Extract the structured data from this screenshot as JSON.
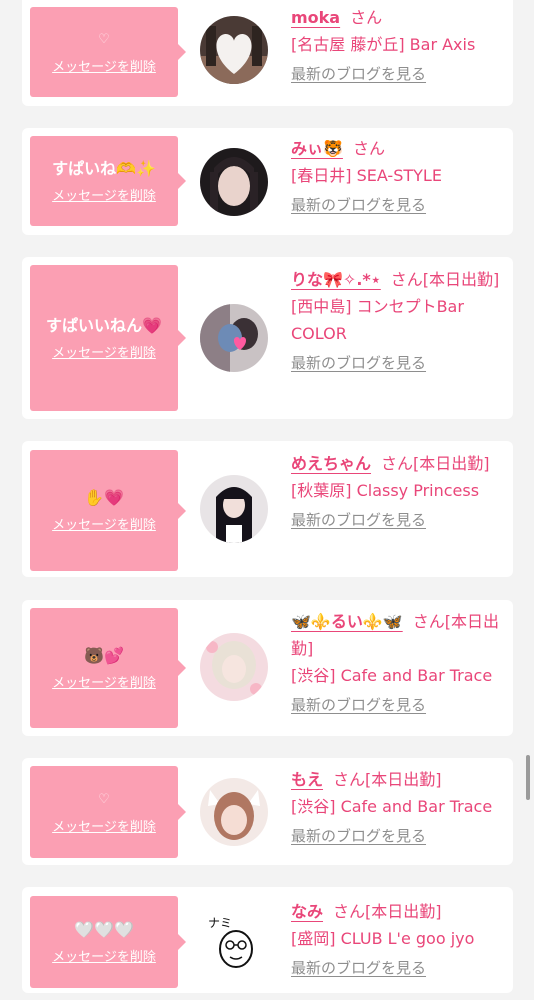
{
  "common": {
    "delete_label": "メッセージを削除",
    "blog_label": "最新のブログを見る"
  },
  "cards": [
    {
      "message": "♡",
      "name": "moka",
      "suffix": "さん",
      "shop": "[名古屋 藤が丘] Bar Axis"
    },
    {
      "message": "すぱいね🫶✨",
      "name": "みぃ🐯",
      "suffix": "さん",
      "shop": "[春日井] SEA-STYLE"
    },
    {
      "message": "すぱいいねん💗",
      "name": "りな🎀✧.*⋆",
      "suffix": "さん[本日出勤]",
      "shop": "[西中島] コンセプトBar COLOR"
    },
    {
      "message": "✋💗",
      "name": "めえちゃん",
      "suffix": "さん[本日出勤]",
      "shop": "[秋葉原] Classy Princess"
    },
    {
      "message": "🐻💕",
      "name": "🦋⚜️るい⚜️🦋",
      "suffix": "さん[本日出勤]",
      "shop": "[渋谷] Cafe and Bar Trace"
    },
    {
      "message": "♡",
      "name": "もえ",
      "suffix": "さん[本日出勤]",
      "shop": "[渋谷] Cafe and Bar Trace"
    },
    {
      "message": "🤍🤍🤍",
      "name": "なみ",
      "suffix": "さん[本日出勤]",
      "shop": "[盛岡] CLUB L'e goo jyo"
    }
  ],
  "avatar_caption": "ナミ"
}
